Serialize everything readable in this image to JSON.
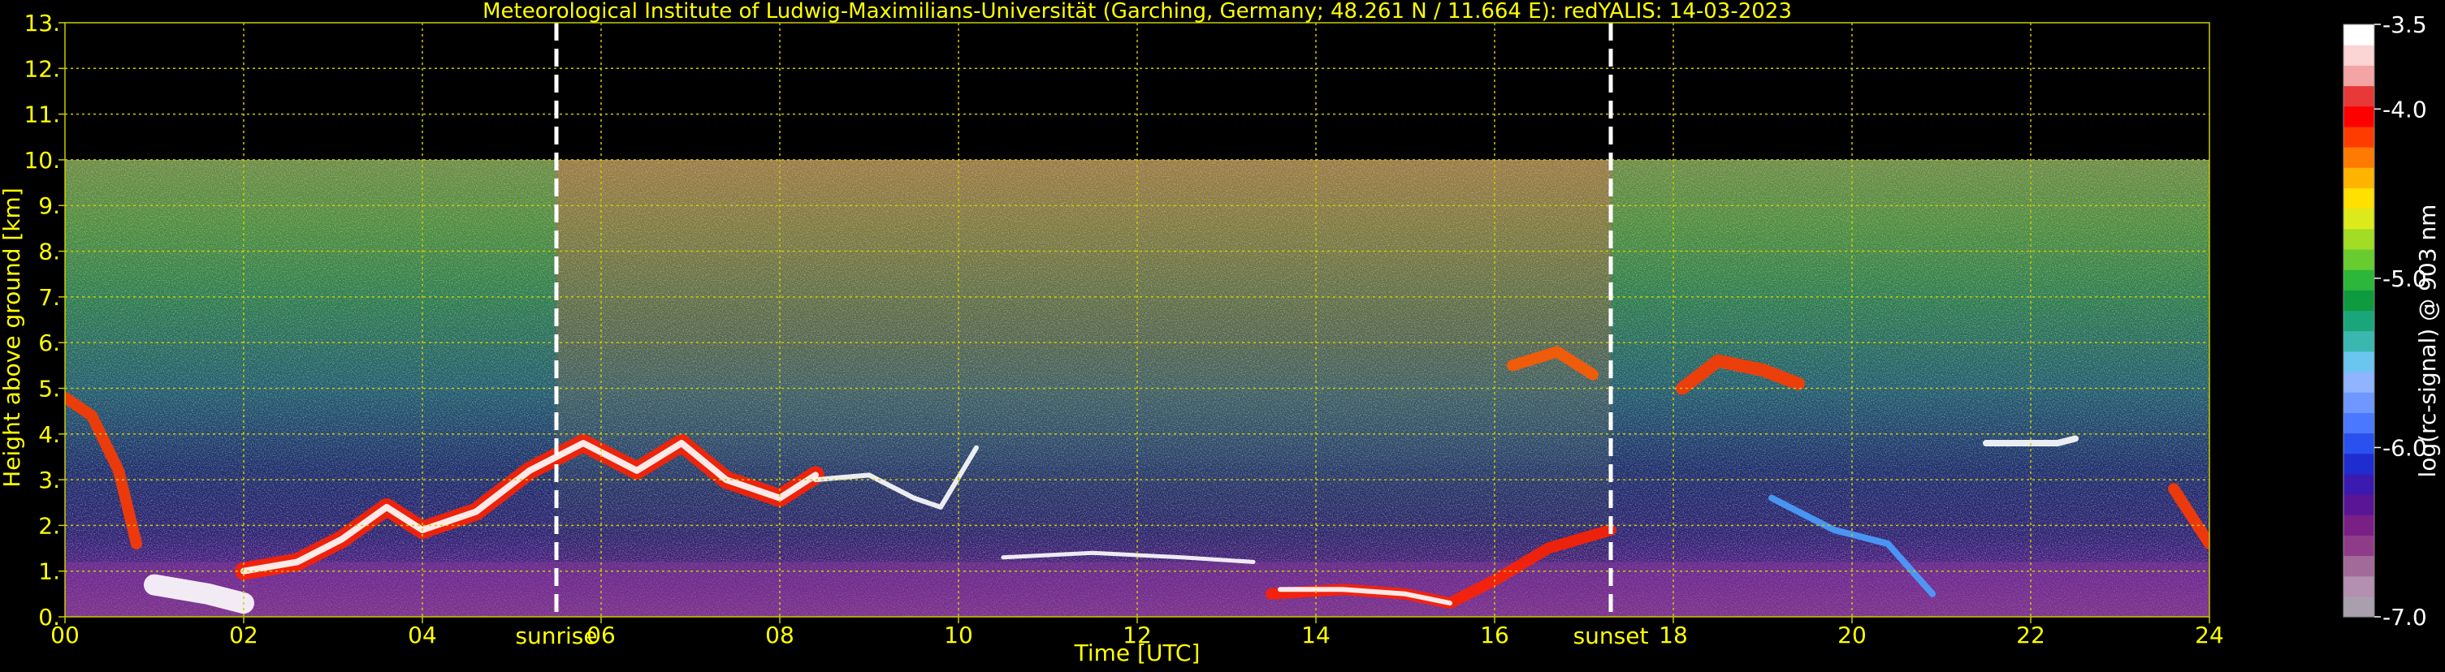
{
  "chart_data": {
    "type": "heatmap",
    "title": "Meteorological Institute of Ludwig-Maximilians-Universität (Garching, Germany; 48.261 N / 11.664 E):    redYALIS: 14-03-2023",
    "xlabel": "Time [UTC]",
    "ylabel": "Height above ground [km]",
    "xlim": [
      0,
      24
    ],
    "ylim": [
      0,
      13
    ],
    "x_ticks": [
      "00",
      "02",
      "04",
      "06",
      "08",
      "10",
      "12",
      "14",
      "16",
      "18",
      "20",
      "22",
      "24"
    ],
    "x_tick_values": [
      0,
      2,
      4,
      6,
      8,
      10,
      12,
      14,
      16,
      18,
      20,
      22,
      24
    ],
    "y_ticks": [
      "0.",
      "1.",
      "2.",
      "3.",
      "4.",
      "5.",
      "6.",
      "7.",
      "8.",
      "9.",
      "10.",
      "11.",
      "12.",
      "13."
    ],
    "y_tick_values": [
      0,
      1,
      2,
      3,
      4,
      5,
      6,
      7,
      8,
      9,
      10,
      11,
      12,
      13
    ],
    "grid": true,
    "data_top_km": 10,
    "markers": [
      {
        "label": "sunrise",
        "x": 5.5
      },
      {
        "label": "sunset",
        "x": 17.3
      }
    ],
    "colorbar": {
      "label": "log(rc-signal) @ 903 nm",
      "range": [
        -7.0,
        -3.5
      ],
      "ticks": [
        "-3.5",
        "-4.0",
        "-5.0",
        "-6.0",
        "-7.0"
      ],
      "tick_values": [
        -3.5,
        -4.0,
        -5.0,
        -6.0,
        -7.0
      ],
      "colors": [
        "#a9a0ad",
        "#b38fb0",
        "#a26a98",
        "#8e3c89",
        "#7a1f85",
        "#5a1596",
        "#3a1ab0",
        "#1f2dd0",
        "#2a50f0",
        "#4a78ff",
        "#6e98ff",
        "#90b4ff",
        "#6ac6ee",
        "#3ab8b0",
        "#1aa67a",
        "#0e9a3e",
        "#2cb63a",
        "#68cc30",
        "#a2dc24",
        "#dcea1c",
        "#ffe000",
        "#ffb400",
        "#ff7a00",
        "#ff3c00",
        "#ff0000",
        "#e83838",
        "#f4a4a4",
        "#fbd4d4",
        "#ffffff"
      ]
    }
  },
  "colors": {
    "text": "#ffff00",
    "grid": "#cccc00",
    "background": "#000000",
    "marker": "#ffffff",
    "colorbar_text": "#ffffff"
  }
}
